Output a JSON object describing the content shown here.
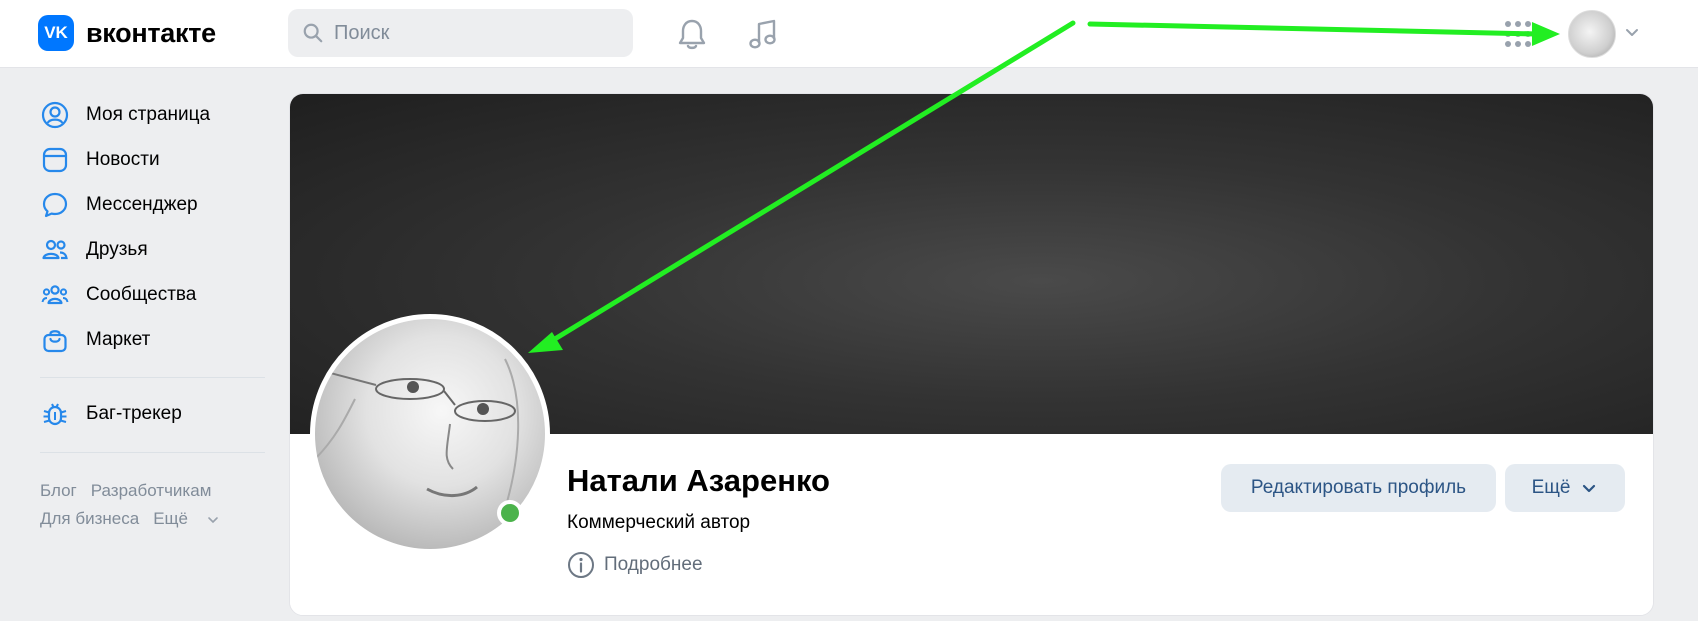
{
  "header": {
    "logo_text": "вконтакте",
    "logo_mark": "VK",
    "search_placeholder": "Поиск"
  },
  "sidebar": {
    "items": [
      {
        "label": "Моя страница",
        "icon": "user-circle-icon"
      },
      {
        "label": "Новости",
        "icon": "news-icon"
      },
      {
        "label": "Мессенджер",
        "icon": "message-icon"
      },
      {
        "label": "Друзья",
        "icon": "friends-icon"
      },
      {
        "label": "Сообщества",
        "icon": "communities-icon"
      },
      {
        "label": "Маркет",
        "icon": "market-bag-icon"
      }
    ],
    "bug_tracker": {
      "label": "Баг-трекер",
      "icon": "bug-icon"
    },
    "footer": {
      "blog": "Блог",
      "developers": "Разработчикам",
      "business": "Для бизнеса",
      "more": "Ещё"
    }
  },
  "profile": {
    "name": "Натали Азаренко",
    "status": "Коммерческий автор",
    "more_info": "Подробнее",
    "online": true,
    "edit_button": "Редактировать профиль",
    "more_button": "Ещё"
  },
  "colors": {
    "accent": "#0077ff",
    "button_bg": "#e5ebf1",
    "button_text": "#2c5585",
    "online": "#4bb34b",
    "annotation_arrow": "#22ee22"
  }
}
